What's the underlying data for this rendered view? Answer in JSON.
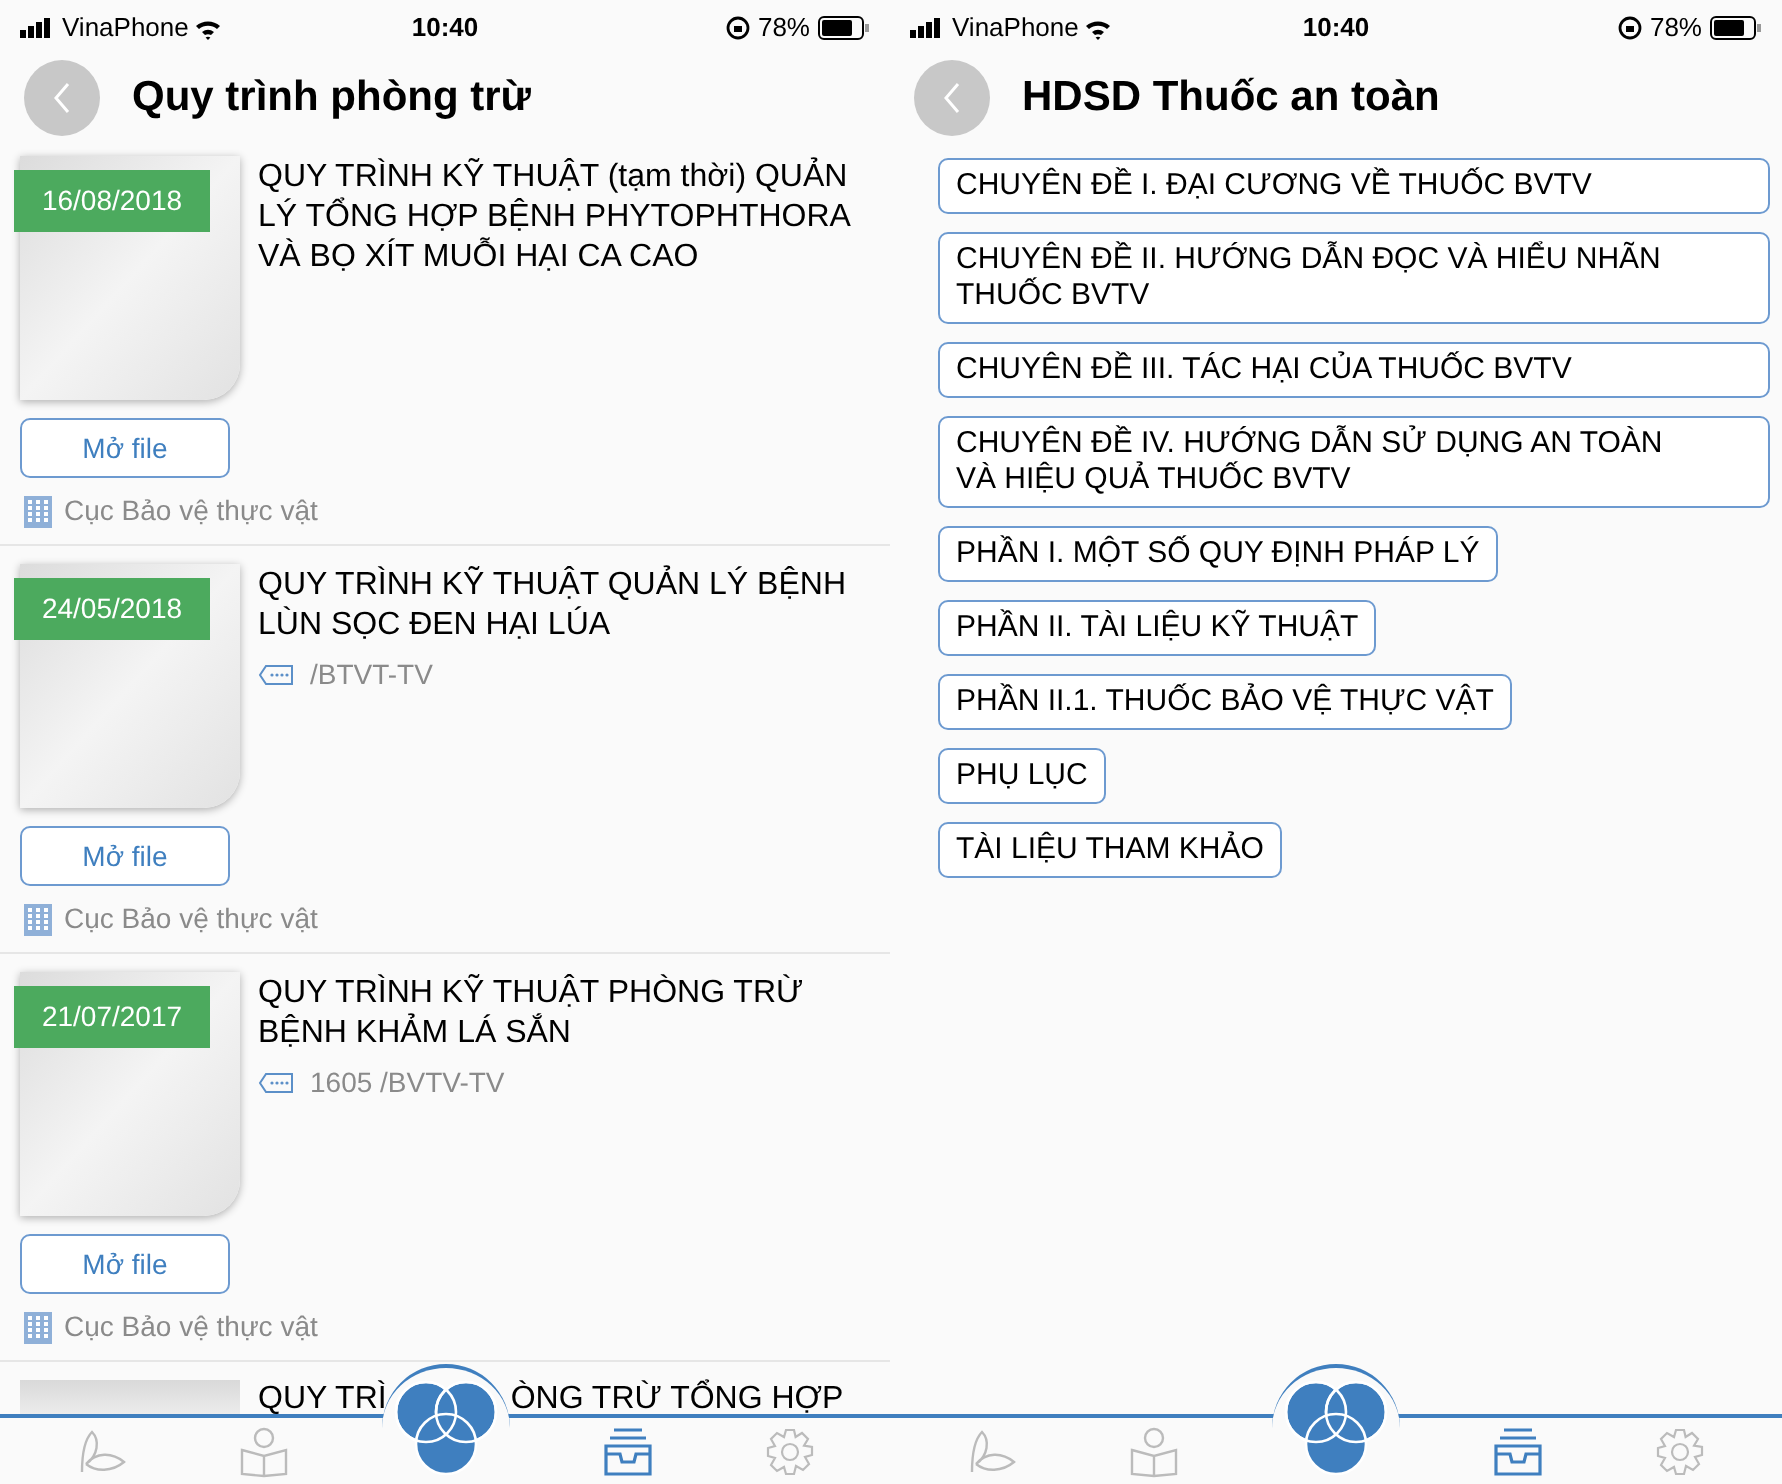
{
  "screens": [
    {
      "status_bar": {
        "carrier": "VinaPhone",
        "time": "10:40",
        "battery": "78%"
      },
      "title": "Quy trình phòng trừ",
      "documents": [
        {
          "date": "16/08/2018",
          "title": "QUY TRÌNH KỸ THUẬT (tạm thời) QUẢN LÝ TỔNG HỢP BỆNH PHYTOPHTHORA VÀ BỌ XÍT MUỖI HẠI CA CAO",
          "open_button": "Mở file",
          "source": "Cục Bảo vệ thực vật"
        },
        {
          "date": "24/05/2018",
          "title": "QUY TRÌNH KỸ THUẬT QUẢN LÝ BỆNH LÙN SỌC ĐEN HẠI LÚA",
          "code": "/BTVT-TV",
          "open_button": "Mở file",
          "source": "Cục Bảo vệ thực vật"
        },
        {
          "date": "21/07/2017",
          "title": "QUY TRÌNH KỸ THUẬT  PHÒNG TRỪ BỆNH KHẢM LÁ SẮN",
          "code": "1605 /BVTV-TV",
          "open_button": "Mở file",
          "source": "Cục Bảo vệ thực vật"
        },
        {
          "title_parts": [
            "QUY TRÌ",
            "ÒNG TRỪ TỔNG HỢP"
          ]
        }
      ],
      "tabs": [
        {
          "selected": false
        },
        {
          "selected": false
        },
        {
          "selected": true
        },
        {
          "selected": false
        }
      ]
    },
    {
      "status_bar": {
        "carrier": "VinaPhone",
        "time": "10:40",
        "battery": "78%"
      },
      "title": "HDSD Thuốc an toàn",
      "sections": [
        {
          "label": "CHUYÊN ĐỀ I. ĐẠI CƯƠNG VỀ THUỐC BVTV",
          "wide": true
        },
        {
          "label": "CHUYÊN ĐỀ II. HƯỚNG DẪN ĐỌC VÀ HIỂU NHÃN THUỐC BVTV",
          "wide": true
        },
        {
          "label": "CHUYÊN ĐỀ III. TÁC HẠI CỦA THUỐC BVTV",
          "wide": true
        },
        {
          "label": "CHUYÊN ĐỀ IV. HƯỚNG DẪN SỬ DỤNG AN TOÀN VÀ HIỆU QUẢ THUỐC BVTV",
          "wide": true
        },
        {
          "label": "PHẦN I. MỘT SỐ QUY ĐỊNH PHÁP LÝ",
          "wide": false
        },
        {
          "label": "PHẦN II. TÀI LIỆU KỸ THUẬT",
          "wide": false
        },
        {
          "label": "PHẦN II.1. THUỐC BẢO VỆ THỰC VẬT",
          "wide": false
        },
        {
          "label": "PHỤ LỤC",
          "wide": false
        },
        {
          "label": "TÀI LIỆU THAM KHẢO",
          "wide": false
        }
      ],
      "tabs": [
        {
          "selected": false
        },
        {
          "selected": false
        },
        {
          "selected": true
        },
        {
          "selected": false
        }
      ]
    }
  ]
}
